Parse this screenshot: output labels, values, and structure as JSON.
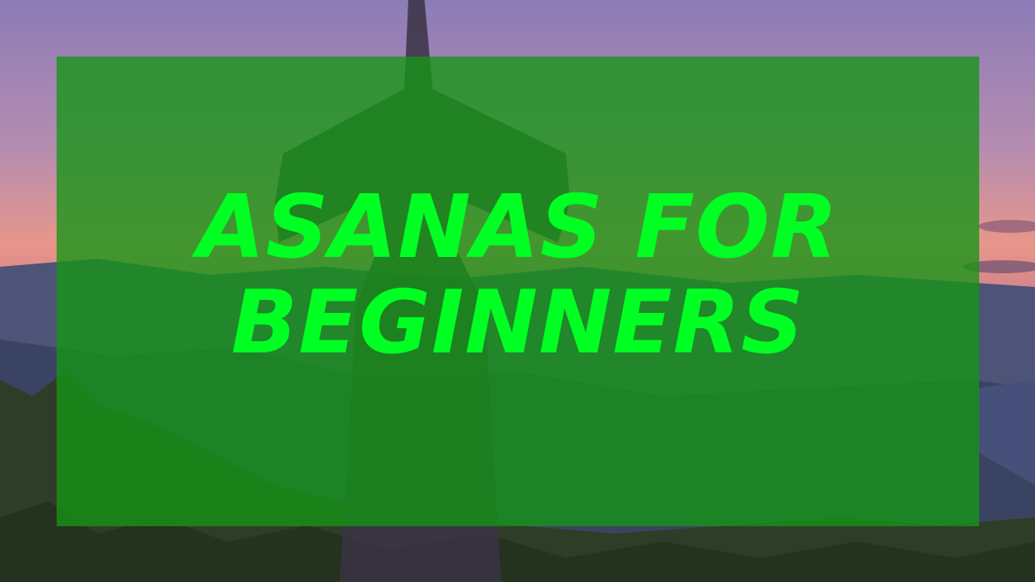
{
  "headline": {
    "line1": "ASANAS FOR",
    "line2": "BEGINNERS"
  },
  "colors": {
    "headline_text": "#00ff22",
    "overlay": "#149614",
    "sky_top": "#7a6aa8",
    "sky_horizon": "#e88a7a",
    "hills": "#3a4a6a",
    "trees": "#2c3a26"
  },
  "background": {
    "scene": "yoga pose at sunset over mountain forest"
  }
}
